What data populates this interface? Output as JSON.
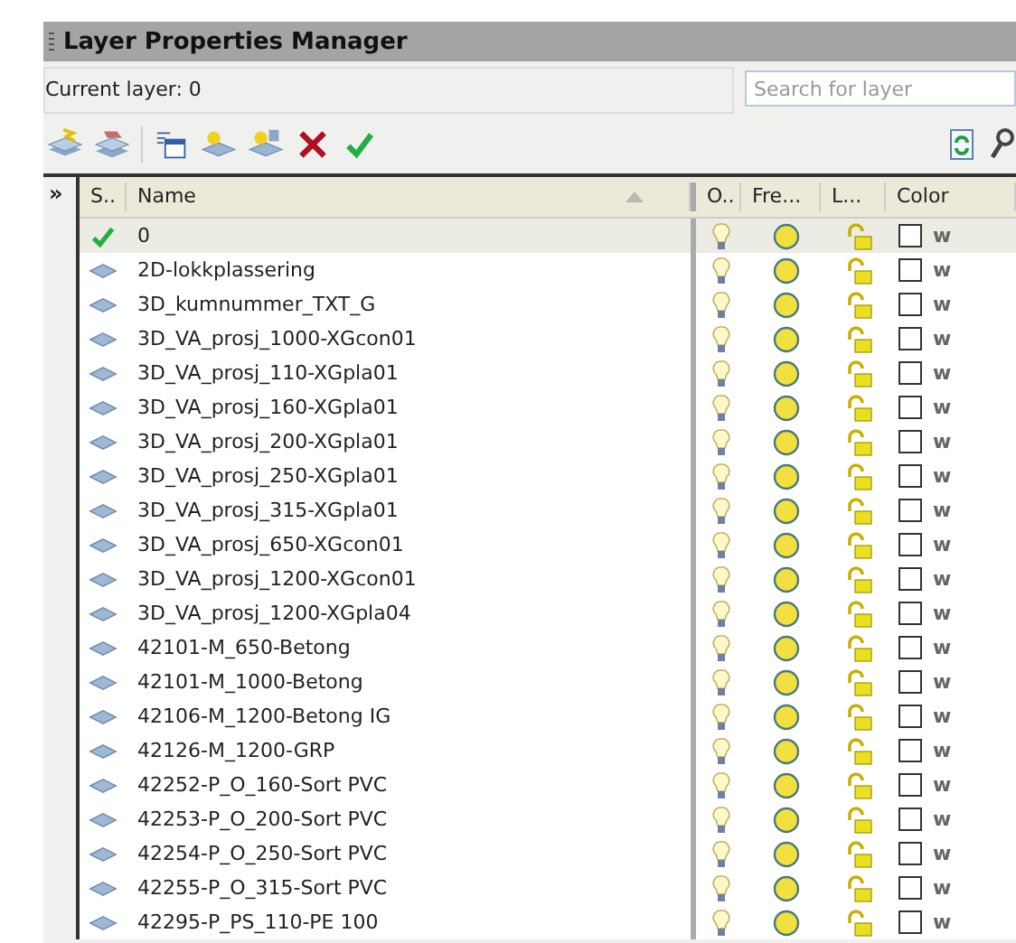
{
  "window": {
    "title": "Layer Properties Manager"
  },
  "current_layer": "Current layer: 0",
  "search": {
    "placeholder": "Search for layer"
  },
  "expand_toggle": "»",
  "table": {
    "columns": [
      "S..",
      "Name",
      "O..",
      "Fre...",
      "L...",
      "Color"
    ],
    "rows": [
      {
        "name": "0",
        "current": true,
        "color_name": "w"
      },
      {
        "name": "2D-lokkplassering",
        "current": false,
        "color_name": "w"
      },
      {
        "name": "3D_kumnummer_TXT_G",
        "current": false,
        "color_name": "w"
      },
      {
        "name": "3D_VA_prosj_1000-XGcon01",
        "current": false,
        "color_name": "w"
      },
      {
        "name": "3D_VA_prosj_110-XGpla01",
        "current": false,
        "color_name": "w"
      },
      {
        "name": "3D_VA_prosj_160-XGpla01",
        "current": false,
        "color_name": "w"
      },
      {
        "name": "3D_VA_prosj_200-XGpla01",
        "current": false,
        "color_name": "w"
      },
      {
        "name": "3D_VA_prosj_250-XGpla01",
        "current": false,
        "color_name": "w"
      },
      {
        "name": "3D_VA_prosj_315-XGpla01",
        "current": false,
        "color_name": "w"
      },
      {
        "name": "3D_VA_prosj_650-XGcon01",
        "current": false,
        "color_name": "w"
      },
      {
        "name": "3D_VA_prosj_1200-XGcon01",
        "current": false,
        "color_name": "w"
      },
      {
        "name": "3D_VA_prosj_1200-XGpla04",
        "current": false,
        "color_name": "w"
      },
      {
        "name": "42101-M_650-Betong",
        "current": false,
        "color_name": "w"
      },
      {
        "name": "42101-M_1000-Betong",
        "current": false,
        "color_name": "w"
      },
      {
        "name": "42106-M_1200-Betong IG",
        "current": false,
        "color_name": "w"
      },
      {
        "name": "42126-M_1200-GRP",
        "current": false,
        "color_name": "w"
      },
      {
        "name": "42252-P_O_160-Sort PVC",
        "current": false,
        "color_name": "w"
      },
      {
        "name": "42253-P_O_200-Sort PVC",
        "current": false,
        "color_name": "w"
      },
      {
        "name": "42254-P_O_250-Sort PVC",
        "current": false,
        "color_name": "w"
      },
      {
        "name": "42255-P_O_315-Sort PVC",
        "current": false,
        "color_name": "w"
      },
      {
        "name": "42295-P_PS_110-PE 100",
        "current": false,
        "color_name": "w"
      }
    ]
  }
}
